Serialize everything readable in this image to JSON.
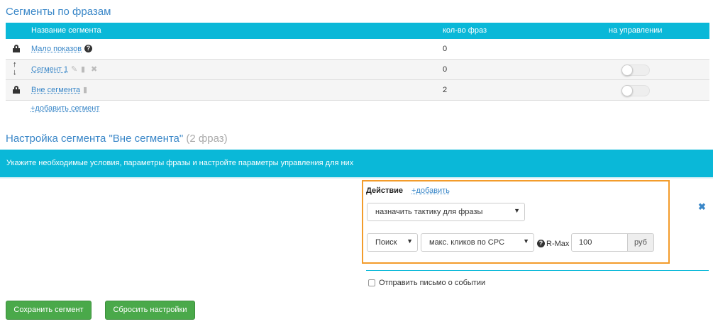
{
  "segments_section": {
    "title": "Сегменты по фразам",
    "columns": {
      "name": "Название сегмента",
      "count": "кол-во фраз",
      "managed": "на управлении"
    },
    "rows": [
      {
        "name": "Мало показов",
        "count": "0",
        "icon": "lock-icon",
        "has_help": true,
        "has_toggle": false
      },
      {
        "name": "Сегмент 1",
        "count": "0",
        "icon": "sort-arrows-icon",
        "has_toggle": true,
        "toggle_on": false
      },
      {
        "name": "Вне сегмента",
        "count": "2",
        "icon": "lock-icon",
        "has_toggle": true,
        "toggle_on": false
      }
    ],
    "add_link": "+добавить сегмент"
  },
  "settings_section": {
    "title": "Настройка сегмента \"Вне сегмента\"",
    "title_suffix": "(2 фраз)",
    "banner": "Укажите необходимые условия, параметры фразы и настройте параметры управления для них"
  },
  "action": {
    "title": "Действие",
    "add_link": "+добавить",
    "tactic_select": "назначить тактику для фразы",
    "search_select": "Поиск",
    "cpc_select": "макс. кликов по CPC",
    "rmax_label": "R-Max",
    "rmax_value": "100",
    "rmax_unit": "руб"
  },
  "notify": {
    "checkbox_label": "Отправить письмо о событии",
    "checked": false
  },
  "buttons": {
    "save": "Сохранить сегмент",
    "reset": "Сбросить настройки"
  },
  "colors": {
    "accent": "#0ab8d8",
    "link": "#3a87c8",
    "highlight_border": "#f39c2b",
    "button_green": "#4aa94a"
  }
}
